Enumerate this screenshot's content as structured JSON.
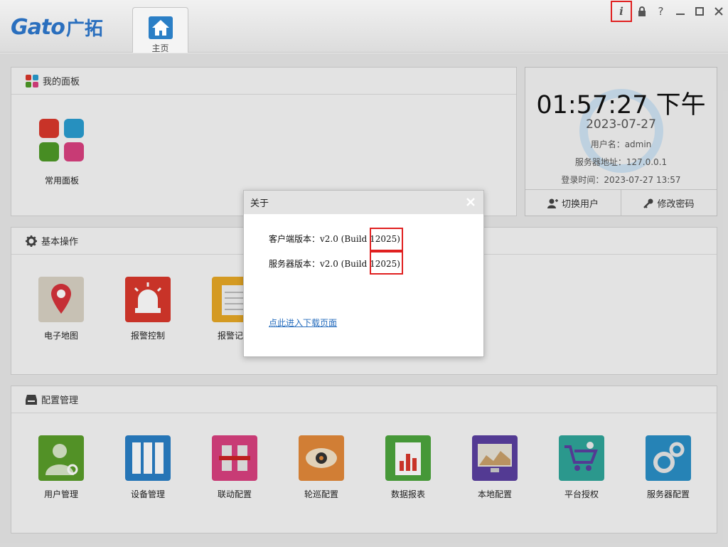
{
  "app": {
    "logo_en": "Gato",
    "logo_cn": "广拓",
    "home_tab": "主页"
  },
  "window_controls": {
    "info": "i",
    "lock": "🔒",
    "help": "?",
    "minimize": "—",
    "maximize": "□",
    "close": "✕"
  },
  "panels": {
    "mypanel": {
      "title": "我的面板",
      "tiles": [
        "常用面板"
      ]
    },
    "basic": {
      "title": "基本操作",
      "tiles": [
        "电子地图",
        "报警控制",
        "报警记录"
      ]
    },
    "config": {
      "title": "配置管理",
      "tiles": [
        "用户管理",
        "设备管理",
        "联动配置",
        "轮巡配置",
        "数据报表",
        "本地配置",
        "平台授权",
        "服务器配置"
      ]
    }
  },
  "clock": {
    "time": "01:57:27 下午",
    "date": "2023-07-27",
    "user": "用户名：admin",
    "server": "服务器地址：127.0.0.1",
    "login_time": "登录时间：2023-07-27 13:57",
    "switch_user": "切换用户",
    "change_password": "修改密码"
  },
  "dialog": {
    "title": "关于",
    "client_version": "客户端版本：v2.0 (Build 12025)",
    "server_version": "服务器版本：v2.0 (Build 12025)",
    "download_link": "点此进入下载页面"
  },
  "colors": {
    "accent": "#2a6fbe",
    "highlight": "#e02020"
  }
}
